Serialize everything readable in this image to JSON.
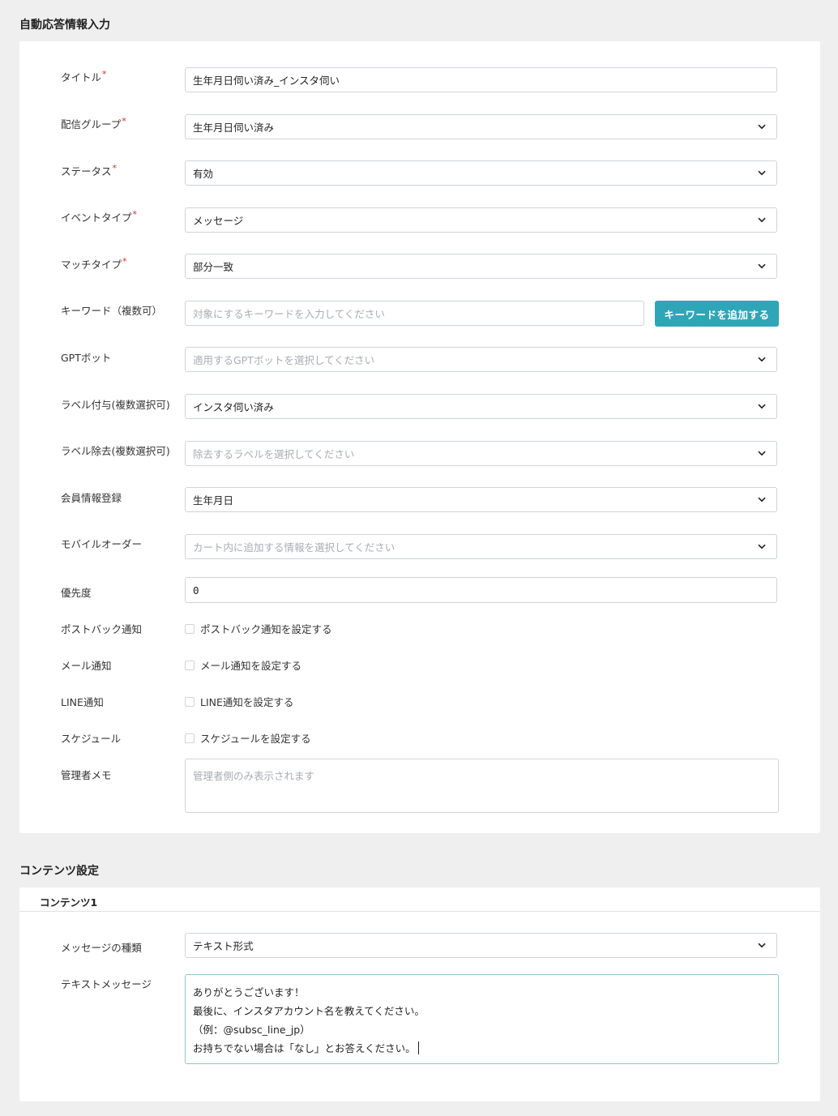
{
  "auto_reply": {
    "section_title": "自動応答情報入力",
    "required_mark": "*",
    "title": {
      "label": "タイトル",
      "value": "生年月日伺い済み_インスタ伺い"
    },
    "delivery_group": {
      "label": "配信グループ",
      "value": "生年月日伺い済み"
    },
    "status": {
      "label": "ステータス",
      "value": "有効"
    },
    "event_type": {
      "label": "イベントタイプ",
      "value": "メッセージ"
    },
    "match_type": {
      "label": "マッチタイプ",
      "value": "部分一致"
    },
    "keyword": {
      "label": "キーワード（複数可）",
      "placeholder": "対象にするキーワードを入力してください",
      "add_button": "キーワードを追加する"
    },
    "gpt_bot": {
      "label": "GPTボット",
      "placeholder": "適用するGPTボットを選択してください"
    },
    "label_add": {
      "label": "ラベル付与(複数選択可)",
      "value": "インスタ伺い済み"
    },
    "label_remove": {
      "label": "ラベル除去(複数選択可)",
      "placeholder": "除去するラベルを選択してください"
    },
    "member_info": {
      "label": "会員情報登録",
      "value": "生年月日"
    },
    "mobile_order": {
      "label": "モバイルオーダー",
      "placeholder": "カート内に追加する情報を選択してください"
    },
    "priority": {
      "label": "優先度",
      "value": "0"
    },
    "postback": {
      "label": "ポストバック通知",
      "checkbox_label": "ポストバック通知を設定する",
      "checked": false
    },
    "mail": {
      "label": "メール通知",
      "checkbox_label": "メール通知を設定する",
      "checked": false
    },
    "line": {
      "label": "LINE通知",
      "checkbox_label": "LINE通知を設定する",
      "checked": false
    },
    "schedule": {
      "label": "スケジュール",
      "checkbox_label": "スケジュールを設定する",
      "checked": false
    },
    "admin_memo": {
      "label": "管理者メモ",
      "placeholder": "管理者側のみ表示されます"
    }
  },
  "contents": {
    "section_title": "コンテンツ設定",
    "item_title": "コンテンツ1",
    "message_type": {
      "label": "メッセージの種類",
      "value": "テキスト形式"
    },
    "text_message": {
      "label": "テキストメッセージ",
      "lines": [
        "ありがとうございます！",
        "最後に、インスタアカウント名を教えてください。",
        "（例：@subsc_line_jp）",
        "お持ちでない場合は「なし」とお答えください。"
      ]
    }
  },
  "colors": {
    "accent": "#2ea6b8",
    "required": "#d62a2a",
    "background": "#efefef",
    "card": "#ffffff"
  },
  "icons": {
    "select_arrow": "chevron-down-icon"
  }
}
